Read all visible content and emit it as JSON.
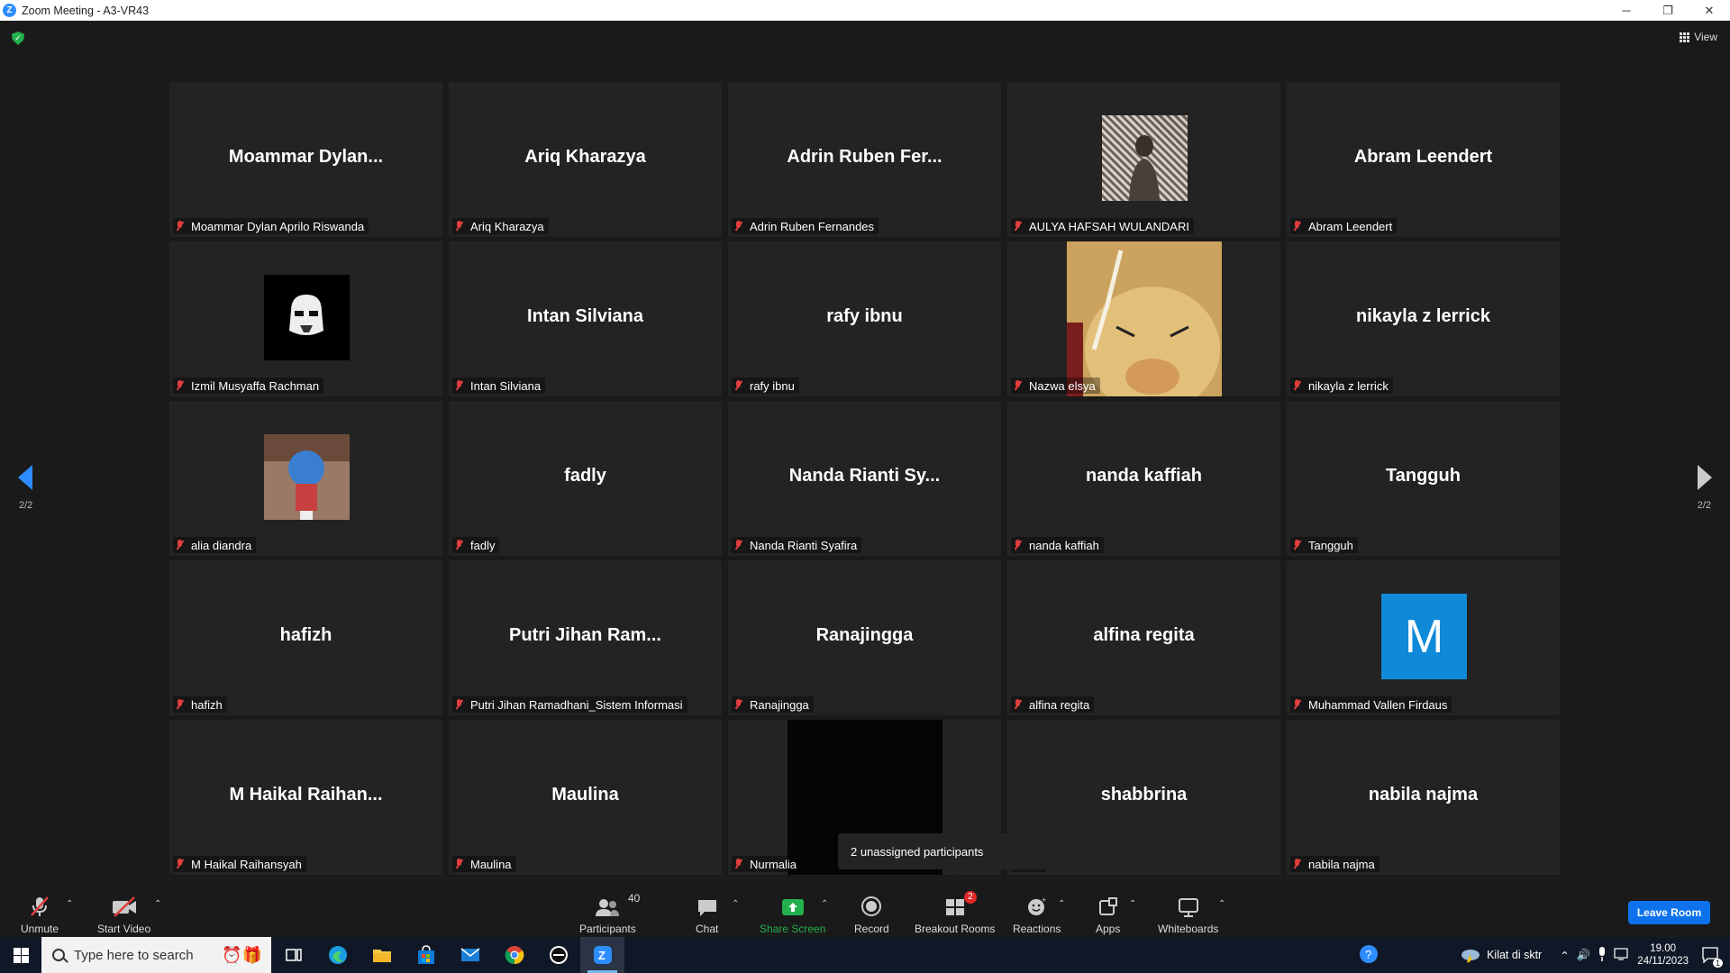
{
  "window": {
    "title": "Zoom Meeting - A3-VR43",
    "minimize": "─",
    "restore": "❐",
    "close": "✕"
  },
  "top": {
    "view_label": "View"
  },
  "pagination": {
    "left": "2/2",
    "right": "2/2"
  },
  "participants": [
    {
      "big": "Moammar  Dylan...",
      "label": "Moammar Dylan Aprilo Riswanda"
    },
    {
      "big": "Ariq Kharazya",
      "label": "Ariq Kharazya"
    },
    {
      "big": "Adrin Ruben Fer...",
      "label": "Adrin Ruben Fernandes"
    },
    {
      "big": "",
      "label": "AULYA HAFSAH WULANDARI"
    },
    {
      "big": "Abram Leendert",
      "label": "Abram Leendert"
    },
    {
      "big": "",
      "label": "Izmil Musyaffa Rachman"
    },
    {
      "big": "Intan Silviana",
      "label": "Intan Silviana"
    },
    {
      "big": "rafy ibnu",
      "label": "rafy ibnu"
    },
    {
      "big": "",
      "label": "Nazwa elsya"
    },
    {
      "big": "nikayla z lerrick",
      "label": "nikayla z lerrick"
    },
    {
      "big": "",
      "label": "alia diandra"
    },
    {
      "big": "fadly",
      "label": "fadly"
    },
    {
      "big": "Nanda Rianti Sy...",
      "label": "Nanda Rianti Syafira"
    },
    {
      "big": "nanda kaffiah",
      "label": "nanda kaffiah"
    },
    {
      "big": "Tangguh",
      "label": "Tangguh"
    },
    {
      "big": "hafizh",
      "label": "hafizh"
    },
    {
      "big": "Putri Jihan Ram...",
      "label": "Putri Jihan Ramadhani_Sistem Informasi"
    },
    {
      "big": "Ranajingga",
      "label": "Ranajingga"
    },
    {
      "big": "alfina regita",
      "label": "alfina regita"
    },
    {
      "big": "",
      "label": "Muhammad Vallen Firdaus",
      "initial": "M"
    },
    {
      "big": "M Haikal Raihan...",
      "label": "M Haikal Raihansyah"
    },
    {
      "big": "Maulina",
      "label": "Maulina"
    },
    {
      "big": "",
      "label": "Nurmalia"
    },
    {
      "big": "shabbrina",
      "label": "na"
    },
    {
      "big": "nabila najma",
      "label": "nabila najma"
    }
  ],
  "tooltip": "2 unassigned participants",
  "toolbar": {
    "unmute": "Unmute",
    "start_video": "Start Video",
    "participants": "Participants",
    "participants_count": "40",
    "chat": "Chat",
    "share_screen": "Share Screen",
    "record": "Record",
    "breakout_rooms": "Breakout Rooms",
    "breakout_badge": "2",
    "reactions": "Reactions",
    "apps": "Apps",
    "whiteboards": "Whiteboards",
    "leave": "Leave Room"
  },
  "taskbar": {
    "search_placeholder": "Type here to search",
    "weather": "Kilat di sktr",
    "time": "19.00",
    "date": "24/11/2023",
    "notifications": "1"
  },
  "colors": {
    "accent": "#2d8cff",
    "share_green": "#23b14d",
    "leave_blue": "#0e72ed",
    "muted_red": "#e03e3e"
  }
}
